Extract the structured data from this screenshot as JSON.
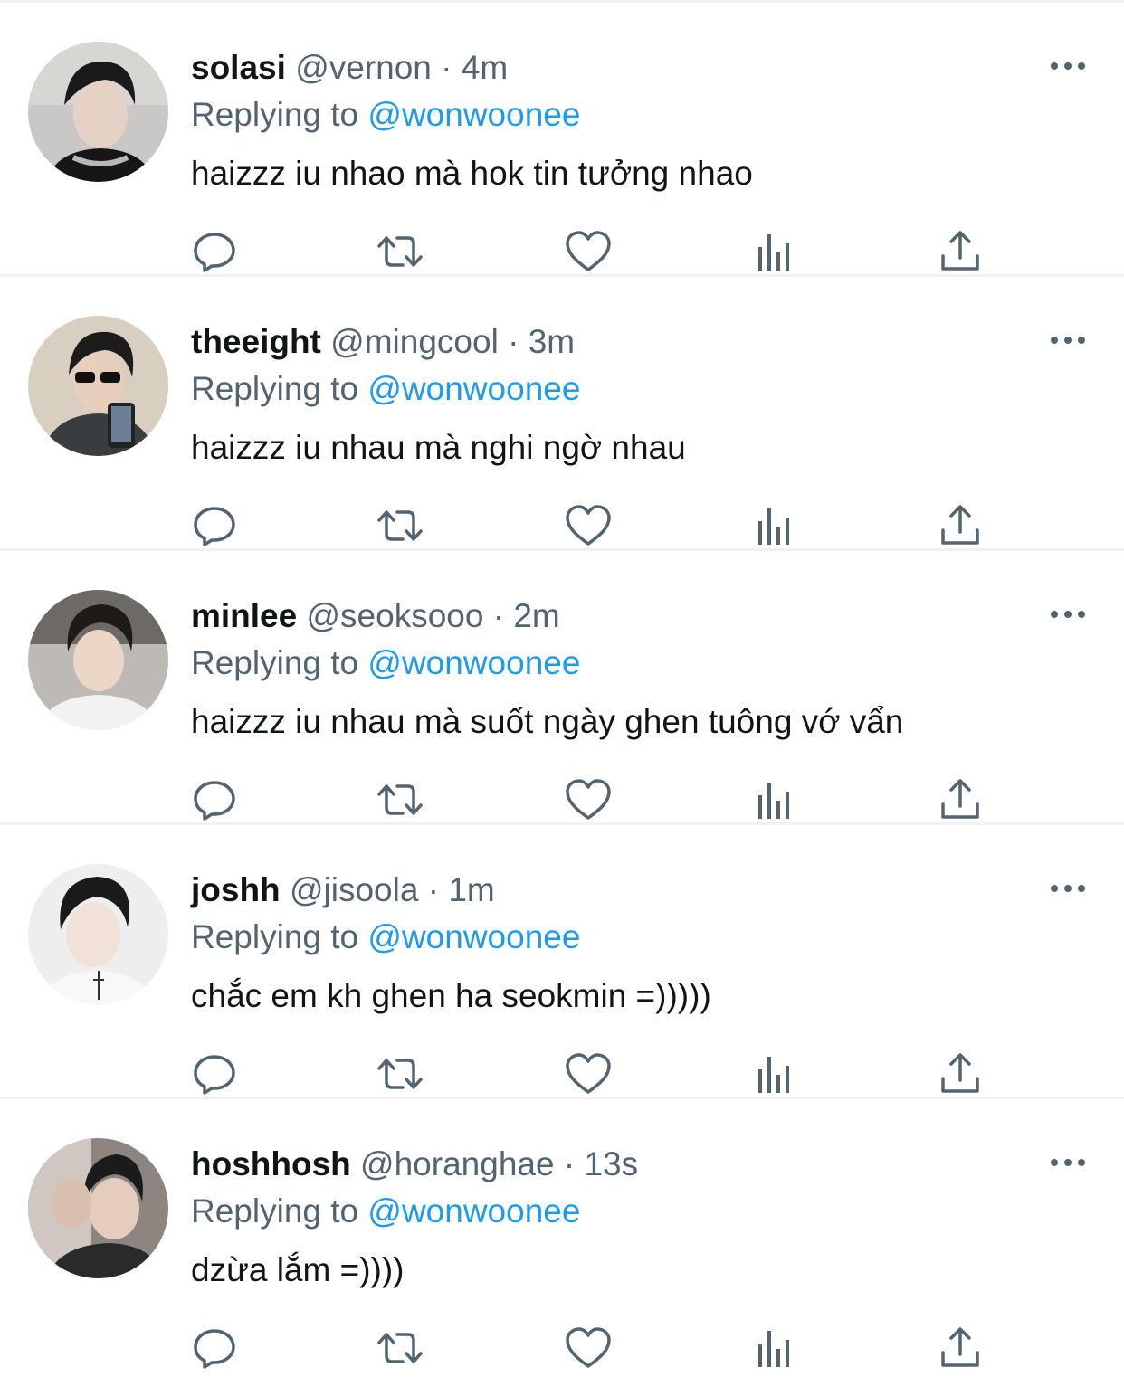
{
  "reply_prefix": "Replying to",
  "colors": {
    "text_primary": "#0f1419",
    "text_secondary": "#536471",
    "link": "#1d9bf0",
    "divider": "#eff1f3"
  },
  "tweets": [
    {
      "name": "solasi",
      "handle": "@vernon",
      "separator": "·",
      "time": "4m",
      "reply_to": "@wonwoonee",
      "text": "haizzz iu nhao mà hok tin tưởng nhao"
    },
    {
      "name": "theeight",
      "handle": "@mingcool",
      "separator": "·",
      "time": "3m",
      "reply_to": "@wonwoonee",
      "text": "haizzz iu nhau mà nghi ngờ nhau"
    },
    {
      "name": "minlee",
      "handle": "@seoksooo",
      "separator": "·",
      "time": "2m",
      "reply_to": "@wonwoonee",
      "text": "haizzz iu nhau mà suốt ngày ghen tuông vớ vẩn"
    },
    {
      "name": "joshh",
      "handle": "@jisoola",
      "separator": "·",
      "time": "1m",
      "reply_to": "@wonwoonee",
      "text": "chắc em kh ghen ha seokmin =)))))"
    },
    {
      "name": "hoshhosh",
      "handle": "@horanghae",
      "separator": "·",
      "time": "13s",
      "reply_to": "@wonwoonee",
      "text": "dzừa lắm =))))"
    }
  ],
  "action_icons": [
    "reply-icon",
    "retweet-icon",
    "like-icon",
    "analytics-icon",
    "share-icon"
  ]
}
